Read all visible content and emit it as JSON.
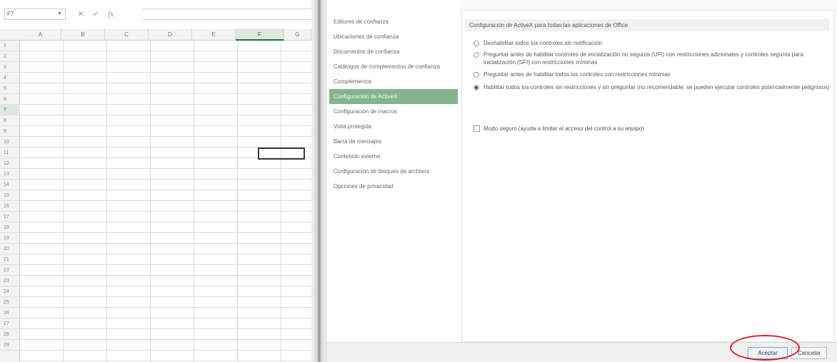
{
  "excel": {
    "name_box": "F7",
    "formula_icons": [
      "✕",
      "✓",
      "fx"
    ],
    "columns": [
      "A",
      "B",
      "C",
      "D",
      "E",
      "F",
      "G"
    ],
    "active_column": "F",
    "rows": [
      "1",
      "2",
      "3",
      "4",
      "5",
      "6",
      "7",
      "8",
      "9",
      "10",
      "11",
      "12",
      "13",
      "14",
      "15",
      "16",
      "17",
      "18",
      "19",
      "20",
      "21",
      "22",
      "23",
      "24",
      "25",
      "26",
      "27",
      "28",
      "29"
    ],
    "active_row": "7"
  },
  "dialog": {
    "nav_items": [
      "Editores de confianza",
      "Ubicaciones de confianza",
      "Documentos de confianza",
      "Catálogos de complementos de confianza",
      "Complementos",
      "Configuración de ActiveX",
      "Configuración de macros",
      "Vista protegida",
      "Barra de mensajes",
      "Contenido externo",
      "Configuración de bloqueo de archivos",
      "Opciones de privacidad"
    ],
    "selected_nav_index": 5,
    "section_title": "Configuración de ActiveX para todas las aplicaciones de Office",
    "options": [
      "Deshabilitar todos los controles sin notificación",
      "Preguntar antes de habilitar controles de inicialización no seguros (UFI) con restricciones adicionales y controles seguros para inicialización (SFI) con restricciones mínimas",
      "Preguntar antes de habilitar todos los controles con restricciones mínimas",
      "Habilitar todos los controles sin restricciones y sin preguntar (no recomendable; se pueden ejecutar controles potencialmente peligrosos)"
    ],
    "selected_option_index": 3,
    "safe_mode_checkbox": "Modo seguro (ayuda a limitar el acceso del control a su equipo)",
    "accept_label": "Aceptar",
    "cancel_label": "Cancelar",
    "highlight_color": "#d0262f",
    "selected_nav_color": "#84b48f"
  }
}
